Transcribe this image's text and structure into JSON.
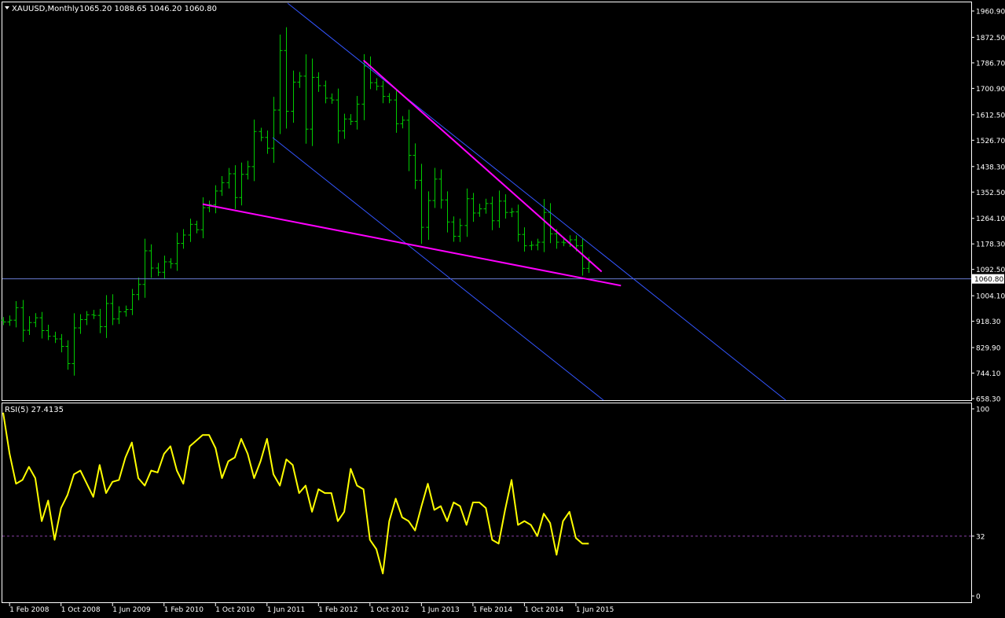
{
  "header": {
    "symbol": "XAUUSD,Monthly",
    "ohlc": "1065.20 1088.65 1046.20 1060.80"
  },
  "price_axis": {
    "ticks": [
      "1960.90",
      "1872.50",
      "1786.70",
      "1700.90",
      "1612.50",
      "1526.70",
      "1438.30",
      "1352.50",
      "1264.10",
      "1178.30",
      "1092.50",
      "1004.10",
      "918.30",
      "829.90",
      "744.10",
      "658.30"
    ],
    "current_price": "1060.80"
  },
  "rsi_panel": {
    "label": "RSI(5) 27.4135",
    "ticks": [
      "100",
      "32",
      "0"
    ]
  },
  "time_axis": {
    "ticks": [
      "1 Feb 2008",
      "1 Oct 2008",
      "1 Jun 2009",
      "1 Feb 2010",
      "1 Oct 2010",
      "1 Jun 2011",
      "1 Feb 2012",
      "1 Oct 2012",
      "1 Jun 2013",
      "1 Feb 2014",
      "1 Oct 2014",
      "1 Jun 2015"
    ]
  },
  "colors": {
    "background": "#000000",
    "bars": "#00cc00",
    "rsi_line": "#ffff00",
    "trendline": "#ff00ff",
    "channel": "#3355ff",
    "grid_text": "#ffffff",
    "level_line": "#6a7bd0"
  },
  "chart_data": [
    {
      "type": "ohlc",
      "title": "XAUUSD,Monthly",
      "bar_count": 92,
      "start": "1 Jan 2008",
      "ylim": [
        658.3,
        1960.9
      ],
      "close": [
        916,
        922,
        964,
        888,
        914,
        930,
        887,
        868,
        859,
        834,
        776,
        896,
        924,
        940,
        938,
        900,
        978,
        926,
        950,
        958,
        1008,
        1042,
        1155,
        1097,
        1083,
        1118,
        1112,
        1180,
        1208,
        1244,
        1226,
        1300,
        1310,
        1356,
        1384,
        1414,
        1334,
        1412,
        1438,
        1556,
        1536,
        1500,
        1628,
        1828,
        1624,
        1722,
        1742,
        1564,
        1738,
        1710,
        1668,
        1662,
        1558,
        1598,
        1590,
        1648,
        1776,
        1720,
        1708,
        1674,
        1662,
        1582,
        1594,
        1476,
        1392,
        1234,
        1324,
        1396,
        1326,
        1252,
        1204,
        1240,
        1330,
        1282,
        1296,
        1314,
        1256,
        1322,
        1284,
        1286,
        1210,
        1172,
        1174,
        1184,
        1284,
        1212,
        1184,
        1182,
        1192,
        1172,
        1096,
        1116
      ],
      "overlays": {
        "horizontal_price": 1060.8,
        "upper_trendline": [
          {
            "date": "1 Sep 2012",
            "price": 1795
          },
          {
            "date": "1 Oct 2015",
            "price": 1085
          }
        ],
        "lower_trendline": [
          {
            "date": "1 Aug 2010",
            "price": 1312
          },
          {
            "date": "1 Jan 2016",
            "price": 1038
          }
        ]
      }
    },
    {
      "type": "line",
      "title": "RSI(5) 27.4135",
      "ylim": [
        0,
        100
      ],
      "level": 32,
      "series": [
        {
          "values": [
            98,
            76,
            60,
            62,
            69,
            63,
            40,
            51,
            30,
            47,
            54,
            65,
            67,
            60,
            53,
            70,
            55,
            61,
            62,
            74,
            82,
            63,
            59,
            67,
            66,
            76,
            80,
            67,
            60,
            80,
            83,
            86,
            86,
            79,
            63,
            72,
            74,
            84,
            76,
            63,
            72,
            84,
            65,
            59,
            73,
            70,
            55,
            59,
            45,
            57,
            55,
            55,
            40,
            45,
            68,
            59,
            57,
            30,
            25,
            12,
            40,
            52,
            42,
            40,
            35,
            48,
            60,
            46,
            48,
            40,
            50,
            48,
            38,
            50,
            50,
            47,
            30,
            28,
            46,
            62,
            38,
            40,
            38,
            32,
            44,
            39,
            22,
            40,
            45,
            31,
            28,
            28
          ]
        }
      ]
    }
  ]
}
